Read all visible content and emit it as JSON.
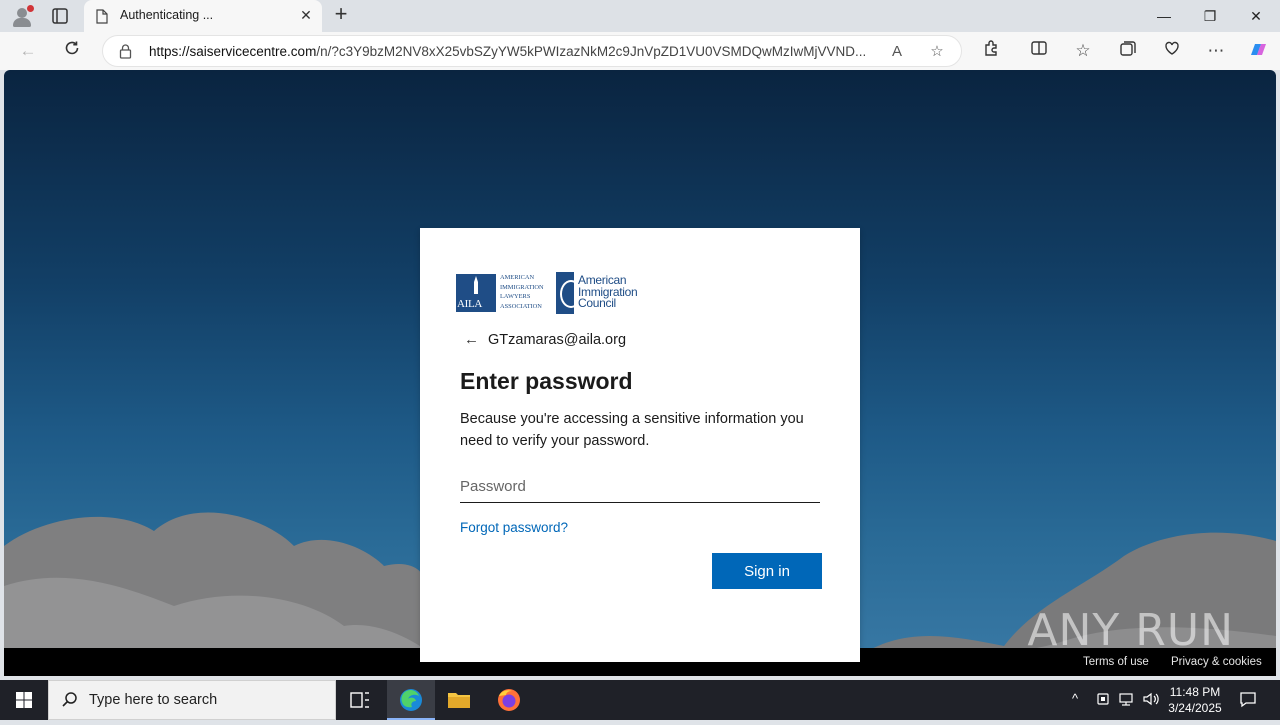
{
  "browser": {
    "tab_title": "Authenticating ...",
    "url_host": "https://saiservicecentre.com",
    "url_path": "/n/?c3Y9bzM2NV8xX25vbSZyYW5kPWIzazNkM2c9JnVpZD1VU0VSMDQwMzIwMjVVND...",
    "window_controls": [
      "—",
      "❐",
      "✕"
    ]
  },
  "login": {
    "logo_aila_abbrev": "AILA",
    "logo_aila_words": [
      "AMERICAN",
      "IMMIGRATION",
      "LAWYERS",
      "ASSOCIATION"
    ],
    "logo_council_words": [
      "American",
      "Immigration",
      "Council"
    ],
    "email": "GTzamaras@aila.org",
    "heading": "Enter password",
    "description": "Because you're accessing a sensitive information you need to verify your password.",
    "password_placeholder": "Password",
    "forgot_label": "Forgot password?",
    "signin_label": "Sign in"
  },
  "page_footer": {
    "terms": "Terms of use",
    "privacy": "Privacy & cookies",
    "watermark": "ANY RUN"
  },
  "taskbar": {
    "search_placeholder": "Type here to search",
    "time": "11:48 PM",
    "date": "3/24/2025"
  },
  "colors": {
    "accent": "#0067b8",
    "brand_navy": "#1f4d86"
  }
}
